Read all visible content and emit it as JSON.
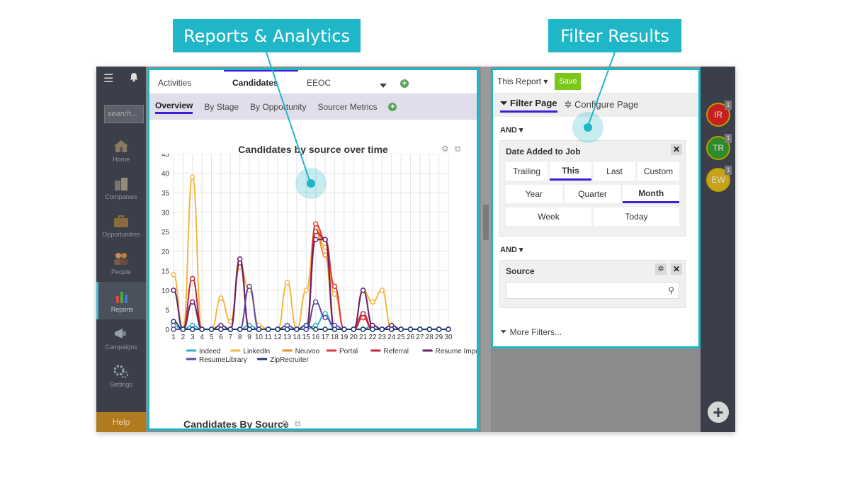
{
  "callouts": {
    "reports": "Reports & Analytics",
    "filter": "Filter Results"
  },
  "nav": {
    "search_placeholder": "search...",
    "items": [
      {
        "label": "Home",
        "icon": "house-icon"
      },
      {
        "label": "Companies",
        "icon": "buildings-icon"
      },
      {
        "label": "Opportunities",
        "icon": "briefcase-icon"
      },
      {
        "label": "People",
        "icon": "people-icon"
      },
      {
        "label": "Reports",
        "icon": "bar-chart-icon",
        "active": true
      },
      {
        "label": "Campaigns",
        "icon": "megaphone-icon"
      },
      {
        "label": "Settings",
        "icon": "gears-icon"
      }
    ],
    "help": "Help"
  },
  "report": {
    "tabs": [
      "Activities",
      "Candidates",
      "EEOC"
    ],
    "active_tab": "Candidates",
    "subtabs": [
      "Overview",
      "By Stage",
      "By Opportunity",
      "Sourcer Metrics"
    ],
    "active_subtab": "Overview",
    "section_title": "Candidates By Source"
  },
  "chart_data": {
    "type": "line",
    "title": "Candidates by source over time",
    "xlabel": "",
    "ylabel": "",
    "x": [
      1,
      2,
      3,
      4,
      5,
      6,
      7,
      8,
      9,
      10,
      11,
      12,
      13,
      14,
      15,
      16,
      17,
      18,
      19,
      20,
      21,
      22,
      23,
      24,
      25,
      26,
      27,
      28,
      29,
      30
    ],
    "ylim": [
      0,
      45
    ],
    "yticks": [
      0,
      5,
      10,
      15,
      20,
      25,
      30,
      35,
      40,
      45
    ],
    "grid": true,
    "legend_position": "bottom",
    "series": [
      {
        "name": "Indeed",
        "color": "#2bb3c9",
        "values": [
          1,
          0,
          1,
          0,
          0,
          0,
          0,
          0,
          1,
          0,
          0,
          0,
          0,
          0,
          0,
          1,
          4,
          0,
          0,
          0,
          0,
          1,
          0,
          0,
          0,
          0,
          0,
          0,
          0,
          0
        ]
      },
      {
        "name": "LinkedIn",
        "color": "#f4b73f",
        "values": [
          14,
          0,
          39,
          0,
          0,
          8,
          2,
          16,
          10,
          1,
          0,
          0,
          12,
          0,
          10,
          26,
          21,
          9,
          0,
          0,
          10,
          7,
          10,
          0,
          0,
          0,
          0,
          0,
          0,
          0
        ]
      },
      {
        "name": "Neuvoo",
        "color": "#ef8c26",
        "values": [
          0,
          0,
          0,
          0,
          0,
          0,
          0,
          0,
          0,
          0,
          0,
          0,
          0,
          0,
          0,
          25,
          19,
          0,
          0,
          0,
          3,
          0,
          0,
          0,
          0,
          0,
          0,
          0,
          0,
          0
        ]
      },
      {
        "name": "Portal",
        "color": "#e23a3a",
        "values": [
          0,
          0,
          0,
          0,
          0,
          0,
          0,
          0,
          0,
          0,
          0,
          0,
          0,
          0,
          0,
          27,
          23,
          11,
          0,
          0,
          3,
          0,
          0,
          0,
          0,
          0,
          0,
          0,
          0,
          0
        ]
      },
      {
        "name": "Referral",
        "color": "#c0283a",
        "values": [
          0,
          0,
          13,
          0,
          0,
          0,
          0,
          17,
          0,
          0,
          0,
          0,
          0,
          0,
          0,
          25,
          23,
          0,
          0,
          0,
          4,
          0,
          0,
          0,
          0,
          0,
          0,
          0,
          0,
          0
        ]
      },
      {
        "name": "Resume Import",
        "color": "#6a1f6a",
        "values": [
          10,
          0,
          7,
          0,
          0,
          1,
          0,
          18,
          0,
          0,
          0,
          0,
          0,
          0,
          0,
          23,
          23,
          0,
          0,
          0,
          10,
          1,
          0,
          1,
          0,
          0,
          0,
          0,
          0,
          0
        ]
      },
      {
        "name": "ResumeLibrary",
        "color": "#5a4aa8",
        "values": [
          0,
          0,
          0,
          0,
          0,
          0,
          0,
          0,
          11,
          0,
          0,
          0,
          1,
          0,
          0,
          7,
          3,
          1,
          0,
          0,
          0,
          0,
          0,
          0,
          0,
          0,
          0,
          0,
          0,
          0
        ]
      },
      {
        "name": "ZipRecruiter",
        "color": "#1e3d7b",
        "values": [
          2,
          0,
          0,
          0,
          0,
          0,
          0,
          0,
          0,
          0,
          0,
          0,
          0,
          0,
          1,
          0,
          0,
          0,
          0,
          0,
          0,
          0,
          0,
          0,
          0,
          0,
          0,
          0,
          0,
          0
        ]
      }
    ]
  },
  "filter": {
    "report_select": "This Report",
    "save": "Save",
    "tabs": {
      "filter_page": "Filter Page",
      "configure_page": "Configure Page"
    },
    "and1": "AND",
    "date_card": {
      "title": "Date Added to Job",
      "row1": [
        "Trailing",
        "This",
        "Last",
        "Custom"
      ],
      "row2": [
        "Year",
        "Quarter",
        "Month"
      ],
      "row3": [
        "Week",
        "Today"
      ],
      "selected_row1": "This",
      "selected_row2": "Month"
    },
    "and2": "AND",
    "source_card": {
      "title": "Source",
      "search_value": ""
    },
    "more_filters": "More Filters..."
  },
  "rightcol": {
    "avatars": [
      {
        "initials": "IR",
        "color": "#c62020",
        "count": "1"
      },
      {
        "initials": "TR",
        "color": "#2f8a2a",
        "count": "1"
      },
      {
        "initials": "EW",
        "color": "#c8a21a",
        "count": "1"
      }
    ]
  }
}
